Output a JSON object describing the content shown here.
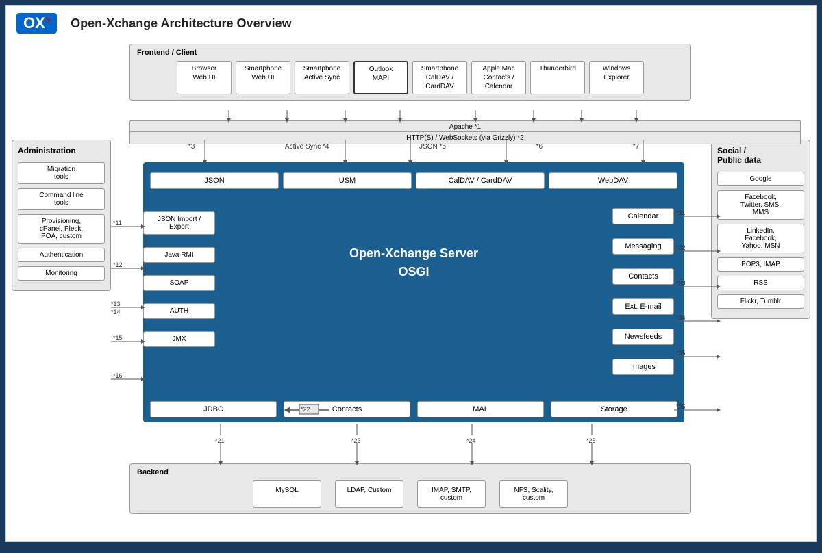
{
  "page": {
    "title": "Open-Xchange Architecture Overview",
    "background": "#1a3a5c"
  },
  "header": {
    "logo": "OX",
    "logo_registered": "®",
    "title": "Open-Xchange Architecture Overview"
  },
  "frontend": {
    "label": "Frontend / Client",
    "clients": [
      {
        "label": "Browser\nWeb UI",
        "style": "normal"
      },
      {
        "label": "Smartphone\nWeb UI",
        "style": "normal"
      },
      {
        "label": "Smartphone\nActive Sync",
        "style": "normal"
      },
      {
        "label": "Outlook\nMAPI",
        "style": "outline-bold"
      },
      {
        "label": "Smartphone\nCalDAV /\nCardDAV",
        "style": "normal"
      },
      {
        "label": "Apple Mac\nContacts /\nCalendar",
        "style": "normal"
      },
      {
        "label": "Thunderbird",
        "style": "normal"
      },
      {
        "label": "Windows\nExplorer",
        "style": "normal"
      }
    ]
  },
  "apache": {
    "bar1": "Apache *1",
    "bar2": "HTTP(S) / WebSockets (via Grizzly) *2"
  },
  "protocol_labels": [
    {
      "text": "*3",
      "sub": ""
    },
    {
      "text": "Active Sync *4",
      "sub": ""
    },
    {
      "text": "JSON *5",
      "sub": ""
    },
    {
      "text": "*6",
      "sub": ""
    },
    {
      "text": "*7",
      "sub": ""
    }
  ],
  "protocols": [
    {
      "label": "JSON"
    },
    {
      "label": "USM"
    },
    {
      "label": "CalDAV / CardDAV"
    },
    {
      "label": "WebDAV"
    }
  ],
  "left_connectors": [
    {
      "label": "JSON Import /\nExport",
      "num": "*11"
    },
    {
      "label": "Java RMI",
      "num": "*12"
    },
    {
      "label": "SOAP",
      "num": "*13 *14"
    },
    {
      "label": "AUTH",
      "num": "*15"
    },
    {
      "label": "JMX",
      "num": "*16"
    }
  ],
  "right_services": [
    {
      "label": "Calendar",
      "num": "*31"
    },
    {
      "label": "Messaging",
      "num": "*32"
    },
    {
      "label": "Contacts",
      "num": "*33"
    },
    {
      "label": "Ext. E-mail",
      "num": "*34"
    },
    {
      "label": "Newsfeeds",
      "num": "*35"
    },
    {
      "label": "Images",
      "num": "*36"
    }
  ],
  "ox_server": {
    "title": "Open-Xchange Server",
    "subtitle": "OSGI"
  },
  "bottom_protos": [
    {
      "label": "JDBC"
    },
    {
      "label": "Contacts"
    },
    {
      "label": "MAL"
    },
    {
      "label": "Storage"
    }
  ],
  "admin_panel": {
    "title": "Administration",
    "items": [
      {
        "label": "Migration\ntools"
      },
      {
        "label": "Command line\ntools"
      },
      {
        "label": "Provisioning,\ncPanel, Plesk,\nPOA, custom"
      },
      {
        "label": "Authentication"
      },
      {
        "label": "Monitoring"
      }
    ]
  },
  "social_panel": {
    "title": "Social /\nPublic data",
    "items": [
      {
        "label": "Google"
      },
      {
        "label": "Facebook,\nTwitter, SMS,\nMMS"
      },
      {
        "label": "LinkedIn,\nFacebook,\nYahoo, MSN"
      },
      {
        "label": "POP3, IMAP"
      },
      {
        "label": "RSS"
      },
      {
        "label": "Flickr, Tumblr"
      }
    ]
  },
  "backend": {
    "label": "Backend",
    "items": [
      {
        "label": "MySQL",
        "num": "*21"
      },
      {
        "label": "LDAP, Custom",
        "num": "*23"
      },
      {
        "label": "IMAP, SMTP,\ncustom",
        "num": "*24"
      },
      {
        "label": "NFS, Scality,\ncustom",
        "num": "*25"
      }
    ]
  },
  "connector_num": "*22"
}
